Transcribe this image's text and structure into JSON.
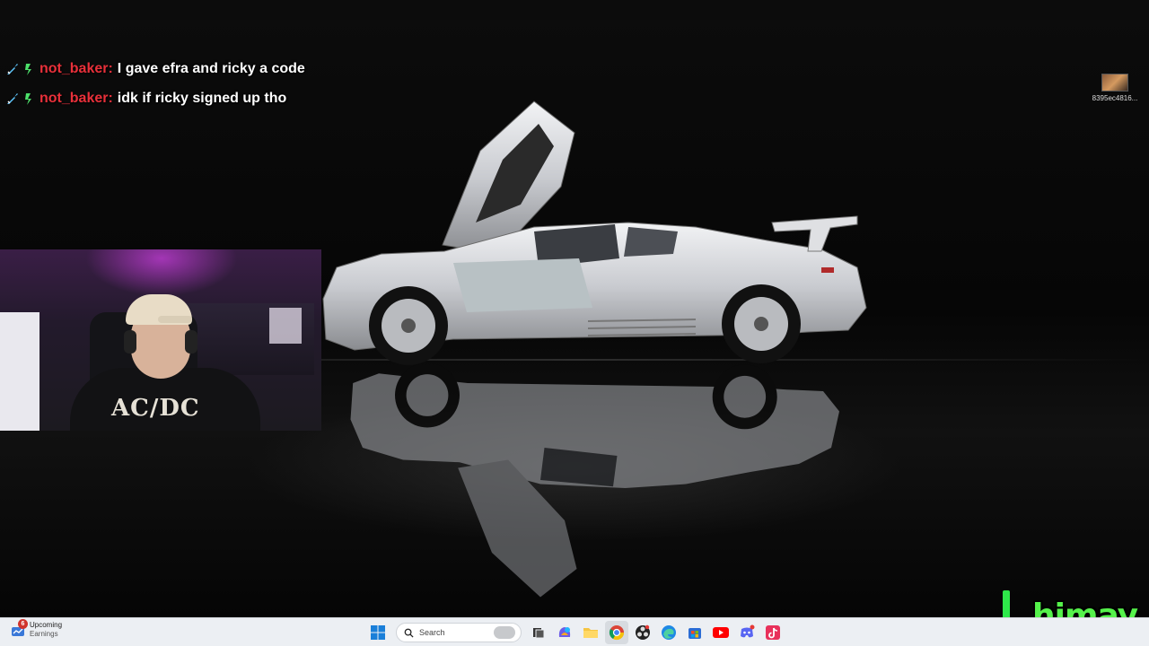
{
  "chat": {
    "messages": [
      {
        "user": "not_baker:",
        "text": "I gave efra and ricky a code"
      },
      {
        "user": "not_baker:",
        "text": "idk if ricky signed up tho"
      }
    ]
  },
  "webcam": {
    "shirt_text": "AC/DC"
  },
  "desktop": {
    "icon_label": "8395ec4816..."
  },
  "overlay": {
    "name": "himay"
  },
  "taskbar": {
    "widget": {
      "badge": "6",
      "title": "Upcoming",
      "subtitle": "Earnings"
    },
    "search": {
      "placeholder": "Search"
    },
    "apps": [
      "windows-start",
      "search",
      "widget-thumbnail",
      "task-view",
      "copilot",
      "file-explorer",
      "chrome",
      "obs",
      "edge",
      "store",
      "youtube",
      "discord",
      "tiktok"
    ]
  },
  "colors": {
    "chat_user": "#e8303a",
    "himay_green": "#55f24b",
    "taskbar_bg": "#eceff3"
  }
}
